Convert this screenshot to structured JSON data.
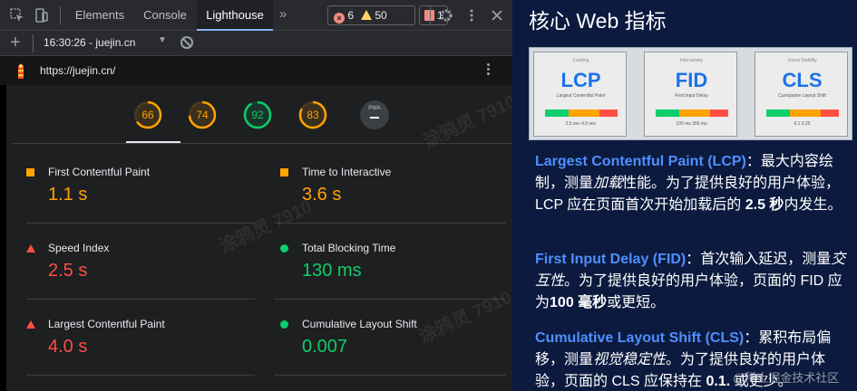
{
  "devtools": {
    "tabs": [
      "Elements",
      "Console",
      "Lighthouse"
    ],
    "more_tabs": "»",
    "error_count": "6",
    "warning_count": "50",
    "issue_count": "1",
    "session": "16:30:26 - juejin.cn",
    "url": "https://juejin.cn/",
    "scores": [
      {
        "value": "66",
        "color": "#ffa400",
        "fraction": 0.66
      },
      {
        "value": "74",
        "color": "#ffa400",
        "fraction": 0.74
      },
      {
        "value": "92",
        "color": "#0cce6b",
        "fraction": 0.92
      },
      {
        "value": "83",
        "color": "#ffa400",
        "fraction": 0.83
      }
    ],
    "pwa_label": "PWA",
    "metrics": [
      {
        "label": "First Contentful Paint",
        "value": "1.1 s",
        "status": "average",
        "color": "#ffa400"
      },
      {
        "label": "Time to Interactive",
        "value": "3.6 s",
        "status": "average",
        "color": "#ffa400"
      },
      {
        "label": "Speed Index",
        "value": "2.5 s",
        "status": "fail",
        "color": "#ff4e42"
      },
      {
        "label": "Total Blocking Time",
        "value": "130 ms",
        "status": "pass",
        "color": "#0cce6b"
      },
      {
        "label": "Largest Contentful Paint",
        "value": "4.0 s",
        "status": "fail",
        "color": "#ff4e42"
      },
      {
        "label": "Cumulative Layout Shift",
        "value": "0.007",
        "status": "pass",
        "color": "#0cce6b"
      }
    ],
    "watermark": "涂鸦灵 7910"
  },
  "article": {
    "title": "核心 Web 指标",
    "cards": [
      {
        "top": "Loading",
        "name": "LCP",
        "sub": "Largest Contentful Paint",
        "ticks": "2.5 sec    4.0 sec"
      },
      {
        "top": "Interactivity",
        "name": "FID",
        "sub": "First Input Delay",
        "ticks": "100 ms    300 ms"
      },
      {
        "top": "Visual Stability",
        "name": "CLS",
        "sub": "Cumulative Layout Shift",
        "ticks": "0.1    0.25"
      }
    ],
    "lcp": {
      "key": "Largest Contentful Paint (LCP)",
      "t1": "：最大内容绘制，测量",
      "em": "加载",
      "t2": "性能。为了提供良好的用户体验，LCP 应在页面首次开始加载后的 ",
      "b": "2.5 秒",
      "t3": "内发生。"
    },
    "fid": {
      "key": "First Input Delay (FID)",
      "t1": "：首次输入延迟，测量",
      "em": "交互性",
      "t2": "。为了提供良好的用户体验，页面的 FID 应为",
      "b": "100 毫秒",
      "t3": "或更短。"
    },
    "cls": {
      "key": "Cumulative Layout Shift (CLS)",
      "t1": "：累积布局偏移，测量",
      "em": "视觉稳定性",
      "t2": "。为了提供良好的用户体验，页面的 CLS 应保持在 ",
      "b": "0.1.",
      "t3": " 或更少。"
    },
    "footer_watermark": "@稀土掘金技术社区"
  }
}
